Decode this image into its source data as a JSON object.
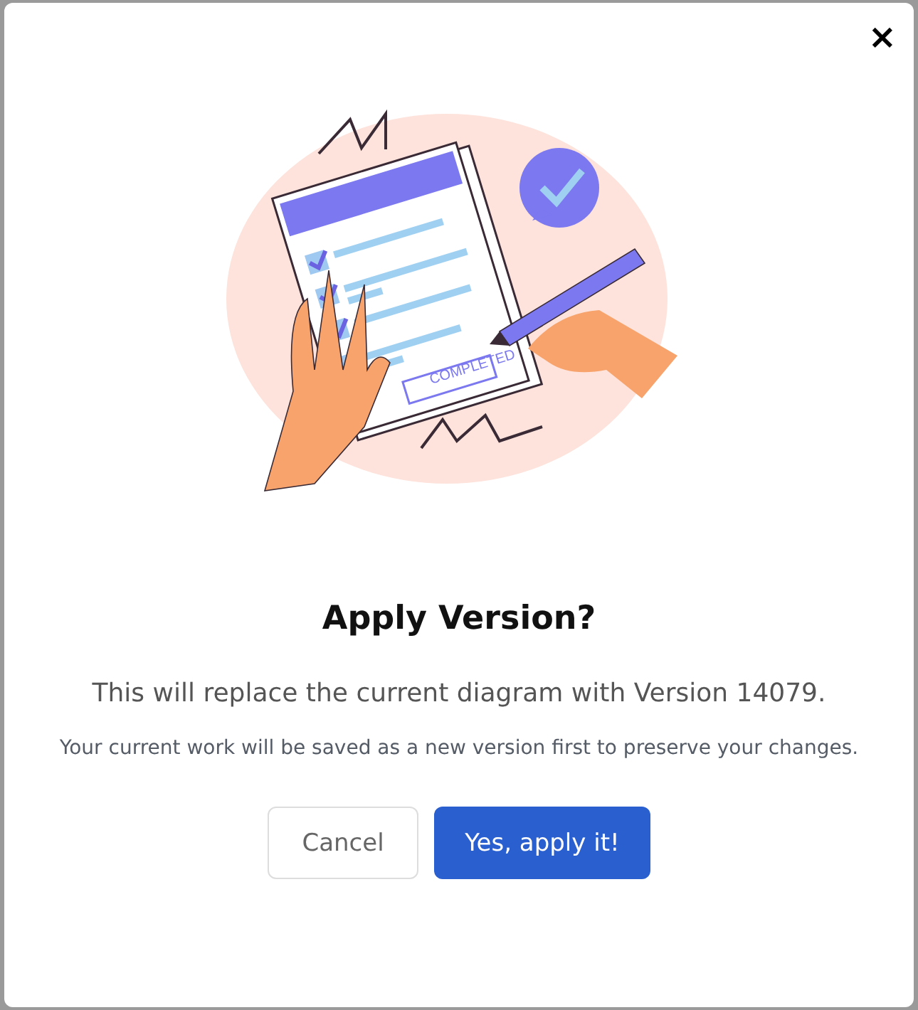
{
  "dialog": {
    "close_label": "×",
    "illustration": {
      "stamp": "COMPLETED"
    },
    "title": "Apply Version?",
    "message": "This will replace the current diagram with Version 14079.",
    "note": "Your current work will be saved as a new version first to preserve your changes.",
    "buttons": [
      {
        "label": "Cancel",
        "kind": "secondary"
      },
      {
        "label": "Yes, apply it!",
        "kind": "primary"
      }
    ]
  }
}
